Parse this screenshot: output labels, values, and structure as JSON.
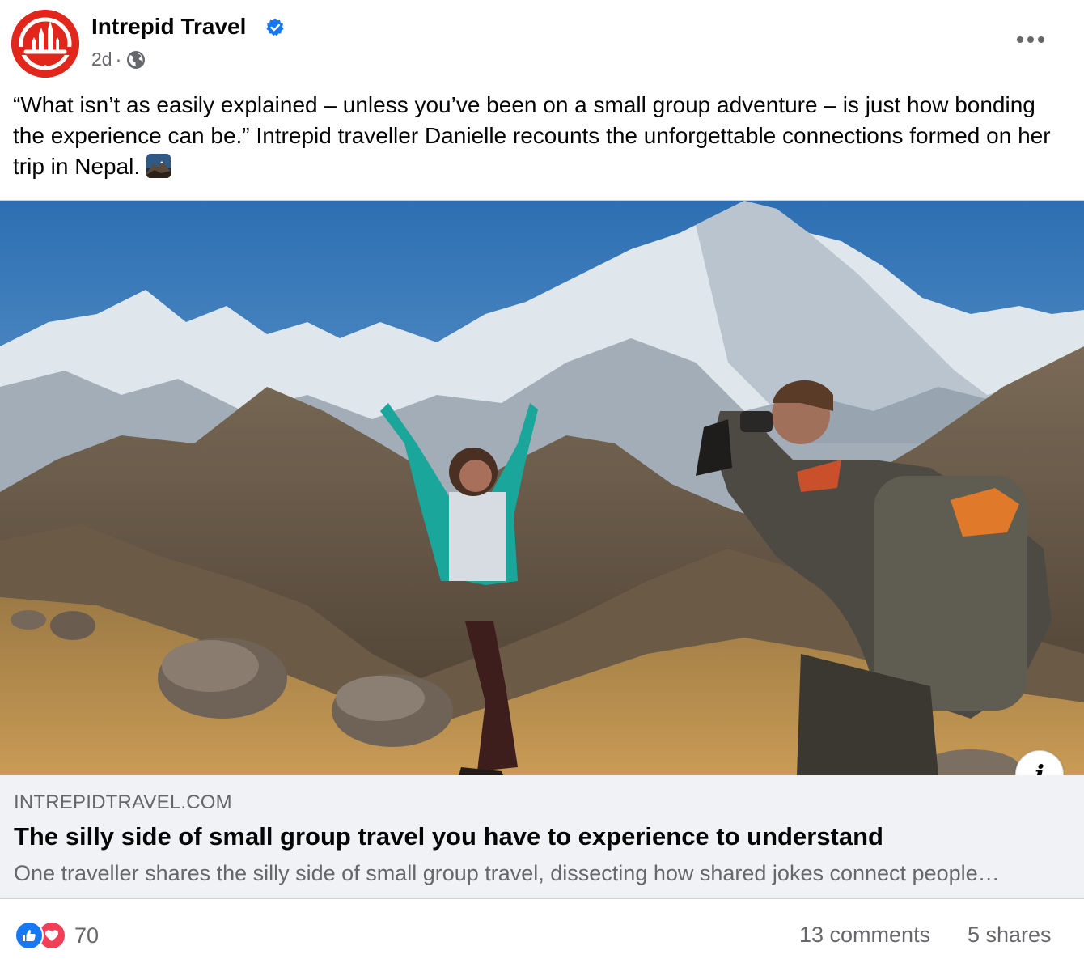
{
  "post": {
    "page_name": "Intrepid Travel",
    "timestamp": "2d",
    "separator": "·",
    "caption": "“What isn’t as easily explained – unless you’ve been on a small group adventure – is just how bonding the experience can be.” Intrepid traveller Danielle recounts the unforgettable connections formed on her trip in Nepal.",
    "caption_emoji": "mountain-emoji",
    "accent_color": "#e1261c",
    "verified_color": "#1877f2"
  },
  "link_preview": {
    "domain": "INTREPIDTRAVEL.COM",
    "title": "The silly side of small group travel you have to experience to understand",
    "description": "One traveller shares the silly side of small group travel, dissecting how shared jokes connect people…",
    "info_label": "i"
  },
  "engagement": {
    "reaction_icons": [
      "like-icon",
      "love-icon"
    ],
    "reaction_count": "70",
    "comments": "13 comments",
    "shares": "5 shares"
  }
}
